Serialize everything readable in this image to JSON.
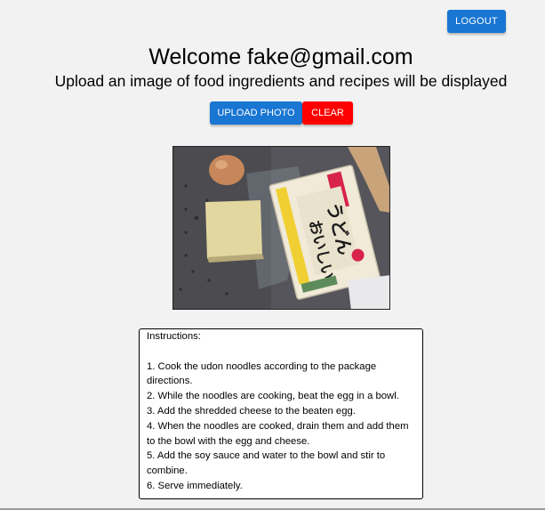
{
  "header": {
    "logout_label": "LOGOUT"
  },
  "main": {
    "title": "Welcome fake@gmail.com",
    "subtitle": "Upload an image of food ingredients and recipes will be displayed",
    "upload_label": "UPLOAD PHOTO",
    "clear_label": "CLEAR"
  },
  "photo": {
    "package_text_1": "おいしい",
    "package_text_2": "うどん"
  },
  "instructions": {
    "heading": "Instructions:",
    "lines": [
      "1. Cook the udon noodles according to the package",
      "directions.",
      "2. While the noodles are cooking, beat the egg in a bowl.",
      "3. Add the shredded cheese to the beaten egg.",
      "4. When the noodles are cooked, drain them and add them",
      "to the bowl with the egg and cheese.",
      "5. Add the soy sauce and water to the bowl and stir to",
      "combine.",
      "6. Serve immediately."
    ]
  },
  "colors": {
    "primary": "#1976d2",
    "danger": "#ff0000",
    "background": "#f2f2f2"
  }
}
